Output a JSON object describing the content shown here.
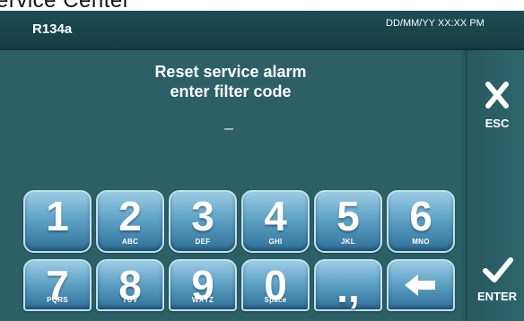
{
  "page": {
    "caption": "ervice Center"
  },
  "header": {
    "refrigerant": "R134a",
    "datetime": "DD/MM/YY XX:XX PM"
  },
  "main": {
    "message_line1": "Reset service alarm",
    "message_line2": "enter filter code",
    "code_value": "_"
  },
  "keypad": {
    "keys": [
      {
        "digit": "1",
        "letters": ""
      },
      {
        "digit": "2",
        "letters": "ABC"
      },
      {
        "digit": "3",
        "letters": "DEF"
      },
      {
        "digit": "4",
        "letters": "GHI"
      },
      {
        "digit": "5",
        "letters": "JKL"
      },
      {
        "digit": "6",
        "letters": "MNO"
      },
      {
        "digit": "7",
        "letters": "PQRS"
      },
      {
        "digit": "8",
        "letters": "TUV"
      },
      {
        "digit": "9",
        "letters": "WXYZ"
      },
      {
        "digit": "0",
        "letters": "Space"
      },
      {
        "digit": ".,",
        "letters": ""
      }
    ],
    "backspace_icon": "backspace-arrow-icon"
  },
  "sidebar": {
    "esc_label": "ESC",
    "esc_icon": "close-x-icon",
    "enter_label": "ENTER",
    "enter_icon": "checkmark-icon"
  },
  "colors": {
    "screen_bg": "#2a5a61",
    "header_bg": "#163c43",
    "key_top": "#9ccde4",
    "key_bottom": "#2f7099",
    "text": "#ffffff"
  }
}
